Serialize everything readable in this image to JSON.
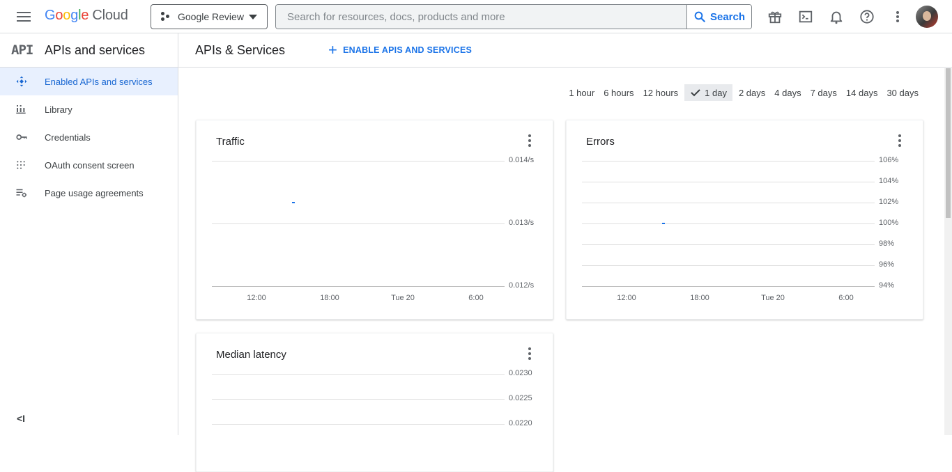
{
  "header": {
    "logo_letters": [
      "G",
      "o",
      "o",
      "g",
      "l",
      "e"
    ],
    "logo_product": "Cloud",
    "project_name": "Google Review",
    "search_placeholder": "Search for resources, docs, products and more",
    "search_button": "Search"
  },
  "sidebar": {
    "api_badge": "API",
    "title": "APIs and services",
    "items": [
      {
        "label": "Enabled APIs and services",
        "icon": "diamond-arrows-icon",
        "active": true
      },
      {
        "label": "Library",
        "icon": "library-icon",
        "active": false
      },
      {
        "label": "Credentials",
        "icon": "key-icon",
        "active": false
      },
      {
        "label": "OAuth consent screen",
        "icon": "dots-grid-icon",
        "active": false
      },
      {
        "label": "Page usage agreements",
        "icon": "settings-list-icon",
        "active": false
      }
    ],
    "collapse": "<I"
  },
  "main": {
    "title": "APIs & Services",
    "enable_button": "ENABLE APIS AND SERVICES",
    "time_ranges": [
      "1 hour",
      "6 hours",
      "12 hours",
      "1 day",
      "2 days",
      "4 days",
      "7 days",
      "14 days",
      "30 days"
    ],
    "selected_range": "1 day"
  },
  "colors": {
    "accent": "#1a73e8",
    "active_bg": "#e8f0fe",
    "selected_range_bg": "#e8eaed"
  },
  "chart_data": [
    {
      "type": "line",
      "title": "Traffic",
      "yticks": [
        "0.014/s",
        "0.013/s",
        "0.012/s"
      ],
      "xticks": [
        "12:00",
        "18:00",
        "Tue 20",
        "6:00"
      ],
      "ylim": [
        0.012,
        0.014
      ],
      "points": [
        {
          "x": "~15:00",
          "y": 0.01333
        }
      ],
      "grid": true
    },
    {
      "type": "line",
      "title": "Errors",
      "yticks": [
        "106%",
        "104%",
        "102%",
        "100%",
        "98%",
        "96%",
        "94%"
      ],
      "xticks": [
        "12:00",
        "18:00",
        "Tue 20",
        "6:00"
      ],
      "ylim": [
        94,
        106
      ],
      "points": [
        {
          "x": "~15:00",
          "y": 100
        }
      ],
      "grid": true
    },
    {
      "type": "line",
      "title": "Median latency",
      "yticks": [
        "0.0230",
        "0.0225",
        "0.0220"
      ],
      "xticks": [],
      "ylim": [
        0.022,
        0.023
      ],
      "points": [],
      "grid": true
    }
  ]
}
